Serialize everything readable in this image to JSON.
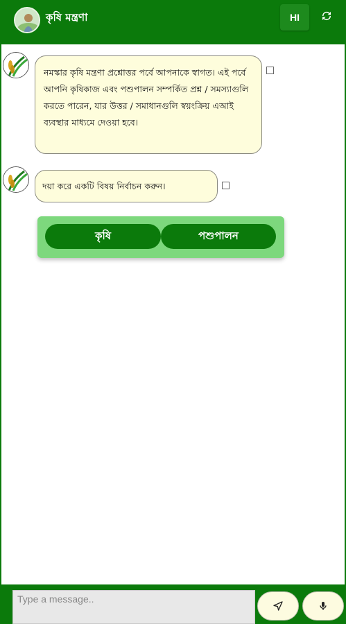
{
  "header": {
    "title": "কৃষি মন্ত্রণা",
    "language_button": "HI",
    "refresh_icon": "refresh-icon"
  },
  "messages": [
    {
      "text": "নমস্কার কৃষি মন্ত্রণা প্রশ্নোত্তর পর্বে আপনাকে স্বাগত। এই পর্বে আপনি কৃষিকাজ এবং পশুপালন সম্পর্কিত প্রশ্ন / সমস্যাগুলি করতে পারেন, যার উত্তর / সমাধানগুলি স্বয়ংক্রিয় এআই ব্যবস্থার মাধ্যমে দেওয়া হবে।"
    },
    {
      "text": "দয়া করে একটি বিষয় নির্বাচন করুন।"
    }
  ],
  "options": [
    "কৃষি",
    "পশুপালন"
  ],
  "composer": {
    "placeholder": "Type a message..",
    "send_icon": "send-icon",
    "mic_icon": "mic-icon"
  },
  "colors": {
    "primary_green": "#0b7a0b",
    "bubble_bg": "#fefddc",
    "option_card_bg": "#7dd87d"
  }
}
